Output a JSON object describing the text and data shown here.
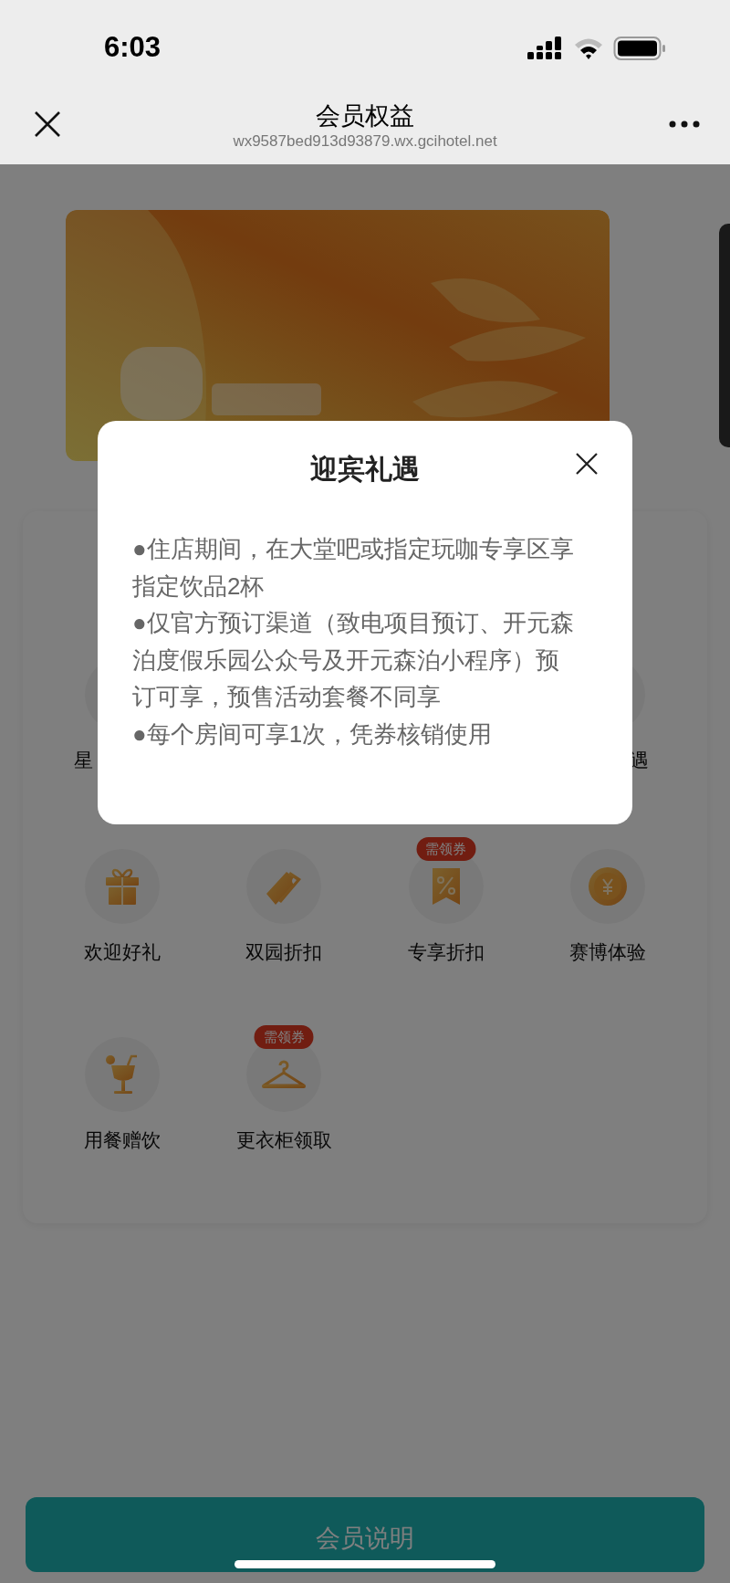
{
  "status_bar": {
    "time": "6:03"
  },
  "nav": {
    "title": "会员权益",
    "subtitle": "wx9587bed913d93879.wx.gcihotel.net"
  },
  "benefits": {
    "partial_labels": [
      "星",
      "遇"
    ],
    "items": [
      {
        "label": "欢迎好礼",
        "kind": "gift"
      },
      {
        "label": "双园折扣",
        "kind": "ticket"
      },
      {
        "label": "专享折扣",
        "kind": "discount",
        "badge": "需领券"
      },
      {
        "label": "赛博体验",
        "kind": "coin"
      },
      {
        "label": "用餐赠饮",
        "kind": "drink"
      },
      {
        "label": "更衣柜领取",
        "kind": "hanger",
        "badge": "需领券"
      }
    ]
  },
  "modal": {
    "title": "迎宾礼遇",
    "lines": [
      "●住店期间，在大堂吧或指定玩咖专享区享指定饮品2杯",
      "●仅官方预订渠道（致电项目预订、开元森泊度假乐园公众号及开元森泊小程序）预订可享，预售活动套餐不同享",
      "●每个房间可享1次，凭券核销使用"
    ]
  },
  "footer_button": "会员说明"
}
